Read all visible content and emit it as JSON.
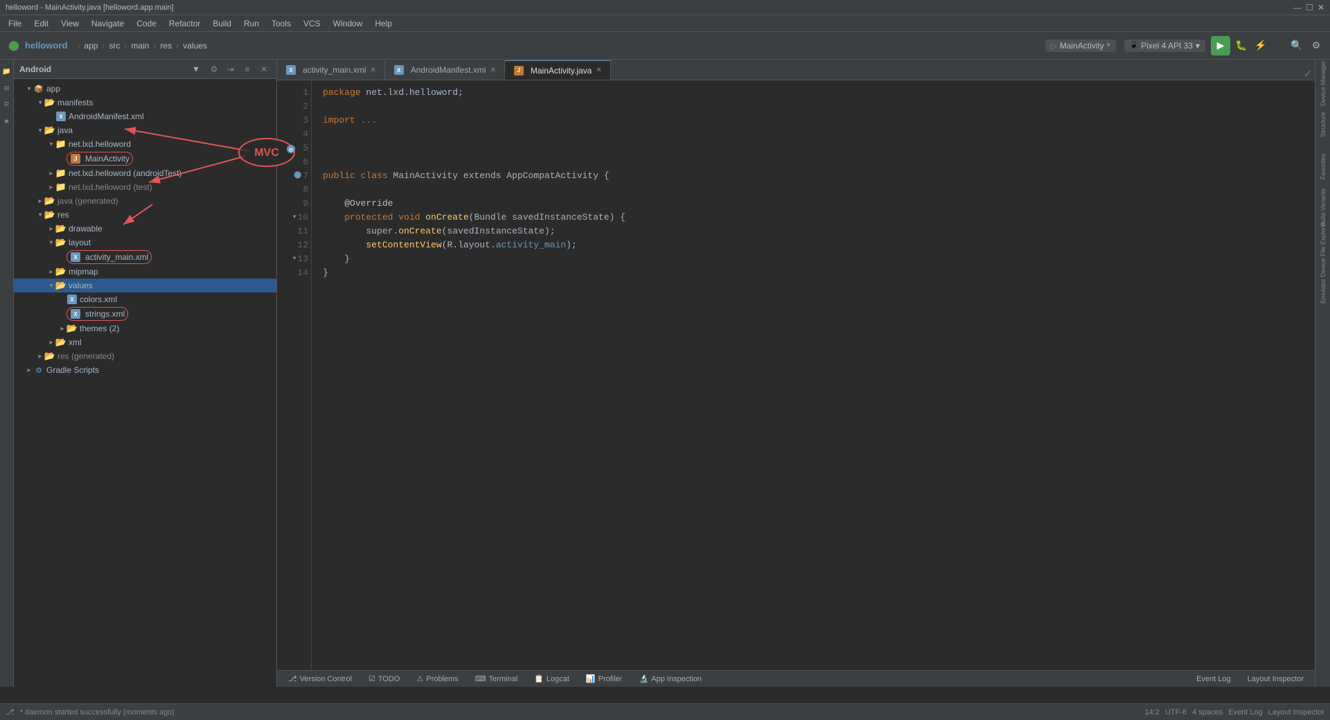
{
  "titlebar": {
    "title": "helloword - MainActivity.java [helloword.app.main]",
    "controls": [
      "—",
      "☐",
      "✕"
    ]
  },
  "menubar": {
    "items": [
      "File",
      "Edit",
      "View",
      "Navigate",
      "Code",
      "Refactor",
      "Build",
      "Run",
      "Tools",
      "VCS",
      "Window",
      "Help"
    ]
  },
  "toolbar": {
    "project_name": "helloword",
    "path": [
      "app",
      "src",
      "main",
      "res",
      "values"
    ],
    "run_config": "MainActivity",
    "device": "Pixel 4 API 33"
  },
  "sidebar": {
    "title": "Android",
    "tree": [
      {
        "id": "app",
        "label": "app",
        "level": 0,
        "type": "module",
        "expanded": true
      },
      {
        "id": "manifests",
        "label": "manifests",
        "level": 1,
        "type": "folder",
        "expanded": true
      },
      {
        "id": "androidmanifest",
        "label": "AndroidManifest.xml",
        "level": 2,
        "type": "xml"
      },
      {
        "id": "java",
        "label": "java",
        "level": 1,
        "type": "folder",
        "expanded": true
      },
      {
        "id": "net.lxd.helloword",
        "label": "net.lxd.helloword",
        "level": 2,
        "type": "package",
        "expanded": true
      },
      {
        "id": "mainactivity",
        "label": "MainActivity",
        "level": 3,
        "type": "java",
        "selected": false,
        "highlighted": true
      },
      {
        "id": "net.lxd.helloword.androidtest",
        "label": "net.lxd.helloword (androidTest)",
        "level": 2,
        "type": "package",
        "collapsed": true
      },
      {
        "id": "net.lxd.helloword.test",
        "label": "net.lxd.helloword (test)",
        "level": 2,
        "type": "package",
        "collapsed": true
      },
      {
        "id": "java-gen",
        "label": "java (generated)",
        "level": 1,
        "type": "folder",
        "collapsed": true
      },
      {
        "id": "res",
        "label": "res",
        "level": 1,
        "type": "folder",
        "expanded": true
      },
      {
        "id": "drawable",
        "label": "drawable",
        "level": 2,
        "type": "folder",
        "collapsed": true
      },
      {
        "id": "layout",
        "label": "layout",
        "level": 2,
        "type": "folder",
        "expanded": true
      },
      {
        "id": "activity_main_xml",
        "label": "activity_main.xml",
        "level": 3,
        "type": "xml",
        "highlighted": true
      },
      {
        "id": "mipmap",
        "label": "mipmap",
        "level": 2,
        "type": "folder",
        "collapsed": true
      },
      {
        "id": "values",
        "label": "values",
        "level": 2,
        "type": "folder",
        "selected": true,
        "expanded": true
      },
      {
        "id": "colors_xml",
        "label": "colors.xml",
        "level": 3,
        "type": "xml"
      },
      {
        "id": "strings_xml",
        "label": "strings.xml",
        "level": 3,
        "type": "xml",
        "highlighted": true
      },
      {
        "id": "themes",
        "label": "themes",
        "level": 3,
        "type": "folder",
        "count": 2,
        "collapsed": true
      },
      {
        "id": "xml",
        "label": "xml",
        "level": 2,
        "type": "folder",
        "collapsed": true
      },
      {
        "id": "res-gen",
        "label": "res (generated)",
        "level": 1,
        "type": "folder",
        "collapsed": true
      },
      {
        "id": "gradle-scripts",
        "label": "Gradle Scripts",
        "level": 0,
        "type": "gradle",
        "collapsed": true
      }
    ]
  },
  "editor": {
    "tabs": [
      {
        "label": "activity_main.xml",
        "icon": "xml",
        "active": false
      },
      {
        "label": "AndroidManifest.xml",
        "icon": "xml",
        "active": false
      },
      {
        "label": "MainActivity.java",
        "icon": "java",
        "active": true
      }
    ],
    "code_lines": [
      {
        "num": 1,
        "content": "package net.lxd.helloword;",
        "parts": [
          {
            "type": "kw",
            "text": "package "
          },
          {
            "type": "pkg",
            "text": "net.lxd.helloword"
          }
        ]
      },
      {
        "num": 2,
        "content": ""
      },
      {
        "num": 3,
        "content": "import ...;",
        "parts": [
          {
            "type": "kw",
            "text": "import "
          },
          {
            "type": "comment",
            "text": "..."
          }
        ]
      },
      {
        "num": 4,
        "content": ""
      },
      {
        "num": 5,
        "content": ""
      },
      {
        "num": 6,
        "content": ""
      },
      {
        "num": 7,
        "content": "public class MainActivity extends AppCompatActivity {",
        "parts": [
          {
            "type": "kw",
            "text": "public "
          },
          {
            "type": "kw",
            "text": "class "
          },
          {
            "type": "cls",
            "text": "MainActivity "
          },
          {
            "type": "plain",
            "text": "extends "
          },
          {
            "type": "cls",
            "text": "AppCompatActivity "
          },
          {
            "type": "plain",
            "text": "{"
          }
        ]
      },
      {
        "num": 8,
        "content": ""
      },
      {
        "num": 9,
        "content": "    @Override"
      },
      {
        "num": 10,
        "content": "    protected void onCreate(Bundle savedInstanceState) {"
      },
      {
        "num": 11,
        "content": "        super.onCreate(savedInstanceState);"
      },
      {
        "num": 12,
        "content": "        setContentView(R.layout.activity_main);"
      },
      {
        "num": 13,
        "content": "    }"
      },
      {
        "num": 14,
        "content": "}"
      }
    ]
  },
  "annotations": {
    "mvc_label": "MVC",
    "arrow_targets": [
      "mainactivity",
      "activity_main_xml",
      "strings_xml"
    ]
  },
  "bottom_tabs": [
    {
      "label": "Version Control"
    },
    {
      "label": "TODO"
    },
    {
      "label": "Problems"
    },
    {
      "label": "Terminal"
    },
    {
      "label": "Logcat"
    },
    {
      "label": "Profiler"
    },
    {
      "label": "App Inspection"
    }
  ],
  "right_panels": [
    {
      "label": "Device Manager"
    },
    {
      "label": "Structure"
    },
    {
      "label": "Favorites"
    },
    {
      "label": "Build Variants"
    },
    {
      "label": "Device File Explorer"
    },
    {
      "label": "Emulator"
    }
  ],
  "status_bar": {
    "git_branch": "* daemon started successfully (moments ago)",
    "cursor_position": "14:2",
    "encoding": "UTF-8",
    "indent": "4 spaces",
    "right_items": [
      "Event Log",
      "Layout Inspector"
    ]
  }
}
